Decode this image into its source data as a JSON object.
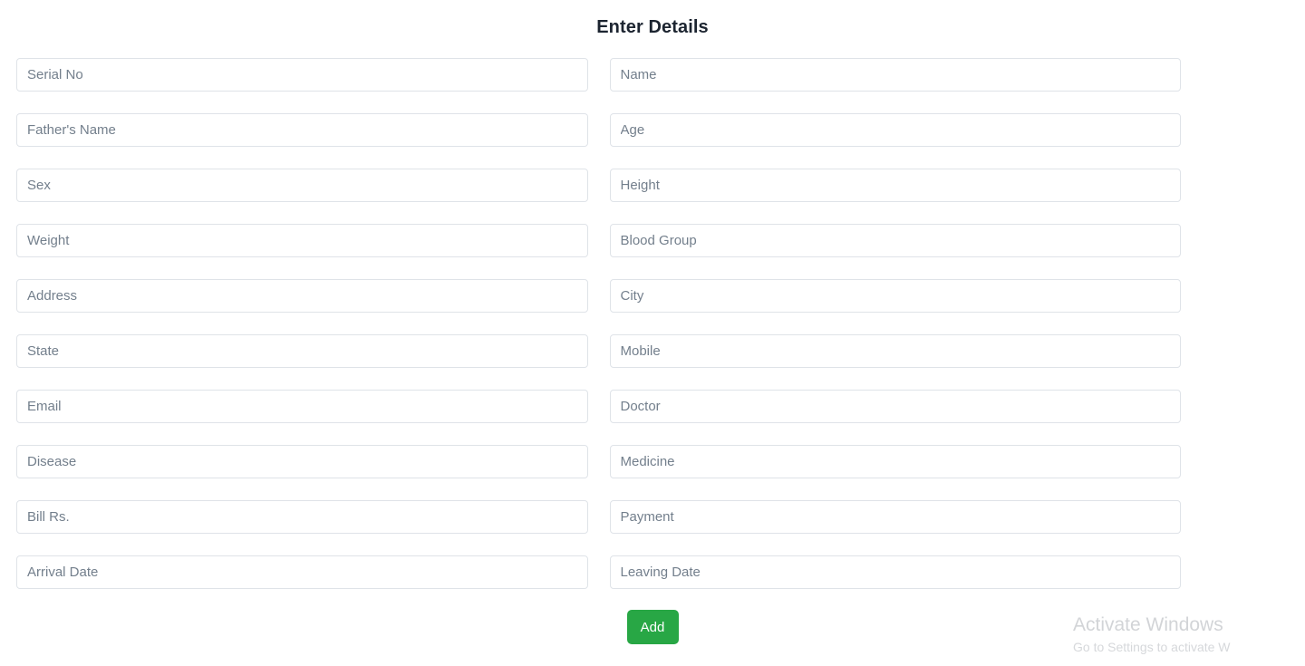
{
  "page": {
    "title": "Enter Details"
  },
  "form": {
    "rows": [
      {
        "left": {
          "placeholder": "Serial No",
          "value": "",
          "name": "serial-no-input"
        },
        "right": {
          "placeholder": "Name",
          "value": "",
          "name": "name-input"
        }
      },
      {
        "left": {
          "placeholder": "Father's Name",
          "value": "",
          "name": "fathers-name-input"
        },
        "right": {
          "placeholder": "Age",
          "value": "",
          "name": "age-input"
        }
      },
      {
        "left": {
          "placeholder": "Sex",
          "value": "",
          "name": "sex-input"
        },
        "right": {
          "placeholder": "Height",
          "value": "",
          "name": "height-input"
        }
      },
      {
        "left": {
          "placeholder": "Weight",
          "value": "",
          "name": "weight-input"
        },
        "right": {
          "placeholder": "Blood Group",
          "value": "",
          "name": "blood-group-input"
        }
      },
      {
        "left": {
          "placeholder": "Address",
          "value": "",
          "name": "address-input"
        },
        "right": {
          "placeholder": "City",
          "value": "",
          "name": "city-input"
        }
      },
      {
        "left": {
          "placeholder": "State",
          "value": "",
          "name": "state-input"
        },
        "right": {
          "placeholder": "Mobile",
          "value": "",
          "name": "mobile-input"
        }
      },
      {
        "left": {
          "placeholder": "Email",
          "value": "",
          "name": "email-input"
        },
        "right": {
          "placeholder": "Doctor",
          "value": "",
          "name": "doctor-input"
        }
      },
      {
        "left": {
          "placeholder": "Disease",
          "value": "",
          "name": "disease-input"
        },
        "right": {
          "placeholder": "Medicine",
          "value": "",
          "name": "medicine-input"
        }
      },
      {
        "left": {
          "placeholder": "Bill Rs.",
          "value": "",
          "name": "bill-rs-input"
        },
        "right": {
          "placeholder": "Payment",
          "value": "",
          "name": "payment-input"
        }
      },
      {
        "left": {
          "placeholder": "Arrival Date",
          "value": "",
          "name": "arrival-date-input"
        },
        "right": {
          "placeholder": "Leaving Date",
          "value": "",
          "name": "leaving-date-input"
        }
      }
    ]
  },
  "actions": {
    "add_label": "Add"
  },
  "watermark": {
    "title": "Activate Windows",
    "subtitle": "Go to Settings to activate W"
  },
  "colors": {
    "accent_green": "#28a745",
    "field_border": "#dfe3e8",
    "placeholder_text": "#737f8c",
    "title_text": "#1c2430",
    "watermark_text": "#d4d6d9",
    "background": "#ffffff"
  }
}
